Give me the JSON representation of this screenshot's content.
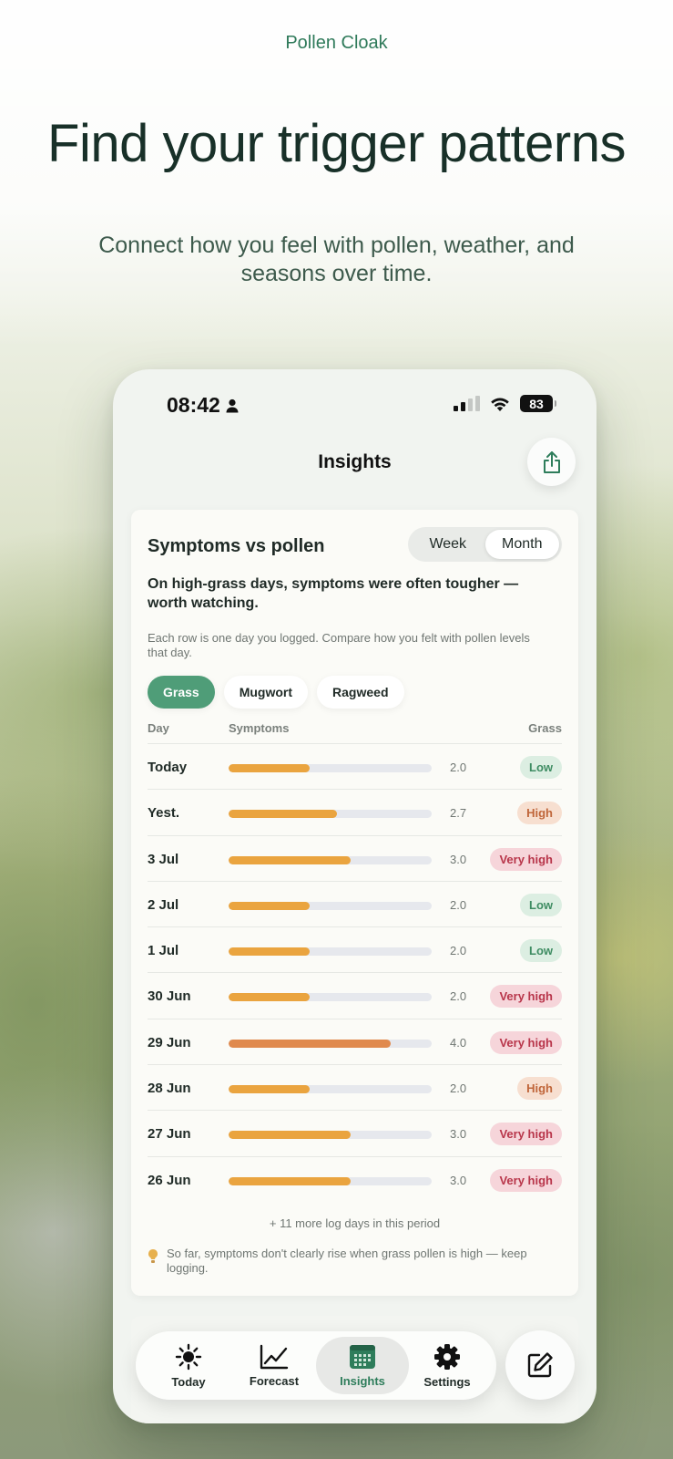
{
  "brand": "Pollen Cloak",
  "headline": "Find your trigger patterns",
  "subhead": "Connect how you feel with pollen, weather, and seasons over time.",
  "status_bar": {
    "time": "08:42",
    "battery": "83"
  },
  "nav": {
    "title": "Insights"
  },
  "card": {
    "title": "Symptoms vs pollen",
    "segments": {
      "week": "Week",
      "month": "Month",
      "selected": "Month"
    },
    "insight": "On high-grass days, symptoms were often tougher — worth watching.",
    "helper": "Each row is one day you logged. Compare how you felt with pollen levels that day.",
    "chips": [
      "Grass",
      "Mugwort",
      "Ragweed"
    ],
    "selected_chip": "Grass",
    "columns": {
      "day": "Day",
      "symptoms": "Symptoms",
      "level": "Grass"
    },
    "rows": [
      {
        "day": "Today",
        "score": "2.0",
        "fraction": 0.4,
        "level": "Low",
        "kind": "low"
      },
      {
        "day": "Yest.",
        "score": "2.7",
        "fraction": 0.535,
        "level": "High",
        "kind": "high"
      },
      {
        "day": "3 Jul",
        "score": "3.0",
        "fraction": 0.6,
        "level": "Very high",
        "kind": "veryhigh"
      },
      {
        "day": "2 Jul",
        "score": "2.0",
        "fraction": 0.4,
        "level": "Low",
        "kind": "low"
      },
      {
        "day": "1 Jul",
        "score": "2.0",
        "fraction": 0.4,
        "level": "Low",
        "kind": "low"
      },
      {
        "day": "30 Jun",
        "score": "2.0",
        "fraction": 0.4,
        "level": "Very high",
        "kind": "veryhigh"
      },
      {
        "day": "29 Jun",
        "score": "4.0",
        "fraction": 0.8,
        "level": "Very high",
        "kind": "veryhigh",
        "color": "#e08a4e"
      },
      {
        "day": "28 Jun",
        "score": "2.0",
        "fraction": 0.4,
        "level": "High",
        "kind": "high"
      },
      {
        "day": "27 Jun",
        "score": "3.0",
        "fraction": 0.6,
        "level": "Very high",
        "kind": "veryhigh"
      },
      {
        "day": "26 Jun",
        "score": "3.0",
        "fraction": 0.6,
        "level": "Very high",
        "kind": "veryhigh"
      }
    ],
    "more": "+ 11 more log days in this period",
    "note": "So far, symptoms don't clearly rise when grass pollen is high — keep logging."
  },
  "tabs": [
    {
      "label": "Today",
      "icon": "sun-icon"
    },
    {
      "label": "Forecast",
      "icon": "line-chart-icon"
    },
    {
      "label": "Insights",
      "icon": "calendar-icon",
      "active": true
    },
    {
      "label": "Settings",
      "icon": "gear-icon"
    }
  ],
  "colors": {
    "accent": "#4f9d78",
    "bar": "#eaa43f",
    "bar_peak": "#e08a4e",
    "low": "#3e8c62",
    "high": "#c0663a",
    "very_high": "#b8354a"
  }
}
